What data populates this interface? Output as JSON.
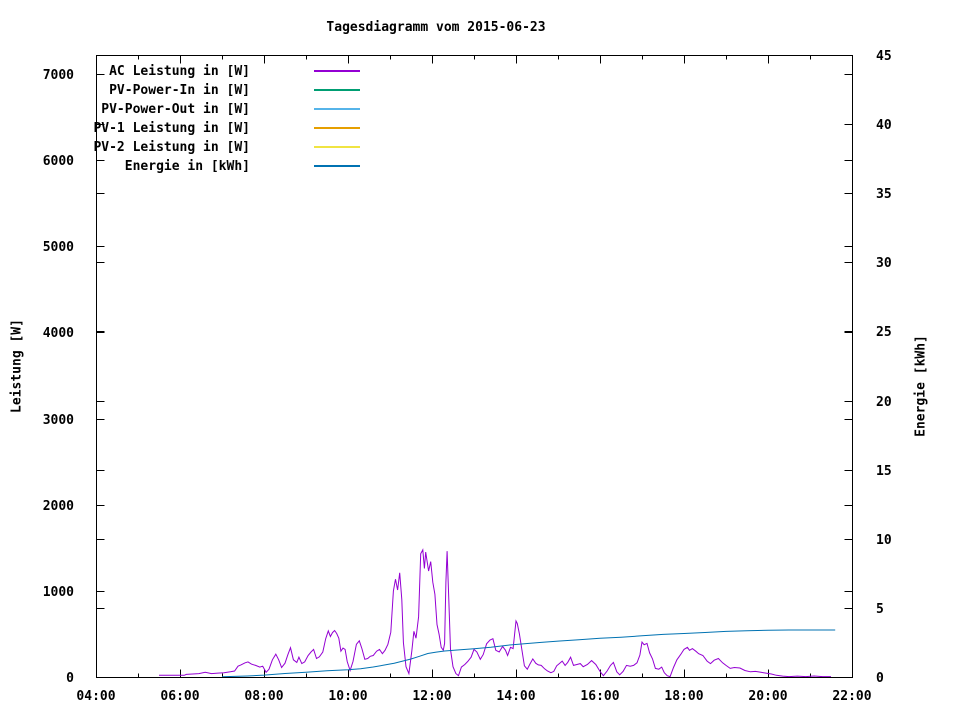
{
  "chart_data": {
    "type": "line",
    "title": "Tagesdiagramm vom 2015-06-23",
    "axes": {
      "x": {
        "unit": "time",
        "range_hours": [
          4,
          22
        ],
        "major_tick_labels": [
          "04:00",
          "06:00",
          "08:00",
          "10:00",
          "12:00",
          "14:00",
          "16:00",
          "18:00",
          "20:00",
          "22:00"
        ],
        "minor_tick_every_hours": 1
      },
      "y_left": {
        "label": "Leistung [W]",
        "ticks": [
          0,
          1000,
          2000,
          3000,
          4000,
          5000,
          6000,
          7000
        ],
        "range": [
          0,
          7240
        ]
      },
      "y_right": {
        "label": "Energie [kWh]",
        "ticks": [
          0,
          5,
          10,
          15,
          20,
          25,
          30,
          35,
          40,
          45
        ],
        "range": [
          0,
          45
        ]
      },
      "grid": false
    },
    "legend_position": "top-left-inside",
    "legend": [
      {
        "label": "AC Leistung in [W]",
        "color": "#9400d3"
      },
      {
        "label": "PV-Power-In in [W]",
        "color": "#009e73"
      },
      {
        "label": "PV-Power-Out in [W]",
        "color": "#56b4e9"
      },
      {
        "label": "PV-1 Leistung in [W]",
        "color": "#e69f00"
      },
      {
        "label": "PV-2 Leistung in [W]",
        "color": "#f0e442"
      },
      {
        "label": "Energie in [kWh]",
        "color": "#0072b2"
      }
    ],
    "series": [
      {
        "name": "AC Leistung in [W]",
        "color": "#9400d3",
        "axis": "left",
        "points": [
          [
            5.5,
            20
          ],
          [
            6.1,
            20
          ],
          [
            6.15,
            30
          ],
          [
            6.3,
            35
          ],
          [
            6.45,
            40
          ],
          [
            6.6,
            55
          ],
          [
            6.75,
            40
          ],
          [
            6.9,
            45
          ],
          [
            7.05,
            50
          ],
          [
            7.2,
            60
          ],
          [
            7.3,
            70
          ],
          [
            7.38,
            125
          ],
          [
            7.45,
            140
          ],
          [
            7.55,
            165
          ],
          [
            7.62,
            175
          ],
          [
            7.7,
            150
          ],
          [
            7.8,
            135
          ],
          [
            7.9,
            115
          ],
          [
            7.97,
            125
          ],
          [
            8.05,
            55
          ],
          [
            8.12,
            90
          ],
          [
            8.2,
            200
          ],
          [
            8.28,
            265
          ],
          [
            8.35,
            200
          ],
          [
            8.42,
            110
          ],
          [
            8.5,
            160
          ],
          [
            8.57,
            260
          ],
          [
            8.63,
            340
          ],
          [
            8.7,
            200
          ],
          [
            8.78,
            170
          ],
          [
            8.83,
            230
          ],
          [
            8.9,
            155
          ],
          [
            8.97,
            175
          ],
          [
            9.05,
            250
          ],
          [
            9.12,
            290
          ],
          [
            9.18,
            320
          ],
          [
            9.25,
            215
          ],
          [
            9.32,
            235
          ],
          [
            9.4,
            290
          ],
          [
            9.47,
            445
          ],
          [
            9.53,
            535
          ],
          [
            9.58,
            470
          ],
          [
            9.63,
            515
          ],
          [
            9.68,
            540
          ],
          [
            9.73,
            505
          ],
          [
            9.78,
            450
          ],
          [
            9.83,
            300
          ],
          [
            9.88,
            335
          ],
          [
            9.93,
            320
          ],
          [
            9.98,
            180
          ],
          [
            10.05,
            75
          ],
          [
            10.12,
            180
          ],
          [
            10.2,
            380
          ],
          [
            10.27,
            420
          ],
          [
            10.33,
            330
          ],
          [
            10.4,
            205
          ],
          [
            10.47,
            215
          ],
          [
            10.53,
            240
          ],
          [
            10.6,
            250
          ],
          [
            10.68,
            300
          ],
          [
            10.75,
            320
          ],
          [
            10.82,
            270
          ],
          [
            10.88,
            310
          ],
          [
            10.95,
            380
          ],
          [
            11.02,
            520
          ],
          [
            11.08,
            1000
          ],
          [
            11.13,
            1135
          ],
          [
            11.18,
            1010
          ],
          [
            11.23,
            1210
          ],
          [
            11.28,
            900
          ],
          [
            11.32,
            400
          ],
          [
            11.38,
            120
          ],
          [
            11.45,
            40
          ],
          [
            11.52,
            300
          ],
          [
            11.57,
            530
          ],
          [
            11.62,
            450
          ],
          [
            11.68,
            700
          ],
          [
            11.73,
            1430
          ],
          [
            11.78,
            1475
          ],
          [
            11.82,
            1260
          ],
          [
            11.85,
            1450
          ],
          [
            11.88,
            1350
          ],
          [
            11.92,
            1230
          ],
          [
            11.97,
            1340
          ],
          [
            12.02,
            1100
          ],
          [
            12.07,
            960
          ],
          [
            12.12,
            610
          ],
          [
            12.17,
            495
          ],
          [
            12.22,
            345
          ],
          [
            12.27,
            310
          ],
          [
            12.3,
            390
          ],
          [
            12.33,
            1100
          ],
          [
            12.36,
            1460
          ],
          [
            12.4,
            900
          ],
          [
            12.44,
            320
          ],
          [
            12.5,
            120
          ],
          [
            12.57,
            40
          ],
          [
            12.63,
            15
          ],
          [
            12.7,
            115
          ],
          [
            12.78,
            145
          ],
          [
            12.85,
            180
          ],
          [
            12.93,
            230
          ],
          [
            13.0,
            320
          ],
          [
            13.07,
            290
          ],
          [
            13.15,
            205
          ],
          [
            13.22,
            260
          ],
          [
            13.3,
            385
          ],
          [
            13.38,
            430
          ],
          [
            13.45,
            445
          ],
          [
            13.52,
            310
          ],
          [
            13.6,
            290
          ],
          [
            13.68,
            355
          ],
          [
            13.75,
            310
          ],
          [
            13.8,
            250
          ],
          [
            13.87,
            345
          ],
          [
            13.93,
            330
          ],
          [
            14.0,
            650
          ],
          [
            14.03,
            620
          ],
          [
            14.08,
            500
          ],
          [
            14.13,
            345
          ],
          [
            14.2,
            130
          ],
          [
            14.27,
            90
          ],
          [
            14.33,
            150
          ],
          [
            14.4,
            210
          ],
          [
            14.47,
            160
          ],
          [
            14.53,
            140
          ],
          [
            14.6,
            135
          ],
          [
            14.68,
            95
          ],
          [
            14.75,
            70
          ],
          [
            14.83,
            50
          ],
          [
            14.9,
            65
          ],
          [
            14.97,
            130
          ],
          [
            15.03,
            155
          ],
          [
            15.1,
            185
          ],
          [
            15.17,
            135
          ],
          [
            15.23,
            170
          ],
          [
            15.3,
            230
          ],
          [
            15.37,
            135
          ],
          [
            15.45,
            145
          ],
          [
            15.53,
            155
          ],
          [
            15.6,
            120
          ],
          [
            15.7,
            145
          ],
          [
            15.8,
            190
          ],
          [
            15.9,
            145
          ],
          [
            16.0,
            65
          ],
          [
            16.08,
            15
          ],
          [
            16.17,
            70
          ],
          [
            16.25,
            135
          ],
          [
            16.32,
            170
          ],
          [
            16.4,
            60
          ],
          [
            16.47,
            25
          ],
          [
            16.55,
            65
          ],
          [
            16.63,
            135
          ],
          [
            16.72,
            125
          ],
          [
            16.8,
            135
          ],
          [
            16.88,
            165
          ],
          [
            16.95,
            255
          ],
          [
            17.0,
            405
          ],
          [
            17.05,
            375
          ],
          [
            17.12,
            390
          ],
          [
            17.18,
            280
          ],
          [
            17.25,
            210
          ],
          [
            17.32,
            100
          ],
          [
            17.4,
            90
          ],
          [
            17.47,
            115
          ],
          [
            17.53,
            50
          ],
          [
            17.6,
            15
          ],
          [
            17.67,
            5
          ],
          [
            17.75,
            110
          ],
          [
            17.83,
            200
          ],
          [
            17.92,
            260
          ],
          [
            18.0,
            320
          ],
          [
            18.08,
            345
          ],
          [
            18.13,
            310
          ],
          [
            18.2,
            330
          ],
          [
            18.28,
            300
          ],
          [
            18.35,
            270
          ],
          [
            18.45,
            250
          ],
          [
            18.55,
            185
          ],
          [
            18.63,
            155
          ],
          [
            18.72,
            195
          ],
          [
            18.82,
            215
          ],
          [
            18.92,
            165
          ],
          [
            19.0,
            135
          ],
          [
            19.1,
            100
          ],
          [
            19.2,
            110
          ],
          [
            19.33,
            105
          ],
          [
            19.45,
            75
          ],
          [
            19.58,
            60
          ],
          [
            19.7,
            65
          ],
          [
            19.83,
            55
          ],
          [
            19.95,
            45
          ],
          [
            20.08,
            35
          ],
          [
            20.2,
            20
          ],
          [
            20.35,
            10
          ],
          [
            20.5,
            5
          ],
          [
            20.7,
            10
          ],
          [
            20.9,
            5
          ],
          [
            21.1,
            12
          ],
          [
            21.3,
            5
          ],
          [
            21.5,
            5
          ]
        ]
      },
      {
        "name": "PV-Power-In in [W]",
        "color": "#009e73",
        "axis": "left",
        "points": []
      },
      {
        "name": "PV-Power-Out in [W]",
        "color": "#56b4e9",
        "axis": "left",
        "points": []
      },
      {
        "name": "PV-1 Leistung in [W]",
        "color": "#e69f00",
        "axis": "left",
        "points": []
      },
      {
        "name": "PV-2 Leistung in [W]",
        "color": "#f0e442",
        "axis": "left",
        "points": []
      },
      {
        "name": "Energie in [kWh]",
        "color": "#0072b2",
        "axis": "right",
        "points": [
          [
            7.0,
            0.02
          ],
          [
            7.3,
            0.04
          ],
          [
            7.6,
            0.07
          ],
          [
            8.0,
            0.14
          ],
          [
            8.5,
            0.25
          ],
          [
            9.0,
            0.35
          ],
          [
            9.5,
            0.45
          ],
          [
            10.0,
            0.52
          ],
          [
            10.3,
            0.6
          ],
          [
            10.6,
            0.72
          ],
          [
            10.9,
            0.88
          ],
          [
            11.1,
            1.0
          ],
          [
            11.3,
            1.15
          ],
          [
            11.5,
            1.3
          ],
          [
            11.7,
            1.5
          ],
          [
            11.9,
            1.7
          ],
          [
            12.1,
            1.8
          ],
          [
            12.3,
            1.88
          ],
          [
            12.6,
            1.95
          ],
          [
            13.0,
            2.05
          ],
          [
            13.4,
            2.15
          ],
          [
            13.8,
            2.3
          ],
          [
            14.2,
            2.4
          ],
          [
            14.6,
            2.5
          ],
          [
            15.0,
            2.6
          ],
          [
            15.5,
            2.7
          ],
          [
            16.0,
            2.8
          ],
          [
            16.5,
            2.88
          ],
          [
            17.0,
            2.98
          ],
          [
            17.5,
            3.08
          ],
          [
            18.0,
            3.15
          ],
          [
            18.5,
            3.22
          ],
          [
            19.0,
            3.3
          ],
          [
            19.5,
            3.35
          ],
          [
            20.0,
            3.38
          ],
          [
            20.5,
            3.4
          ],
          [
            21.0,
            3.4
          ],
          [
            21.6,
            3.4
          ]
        ]
      }
    ]
  }
}
